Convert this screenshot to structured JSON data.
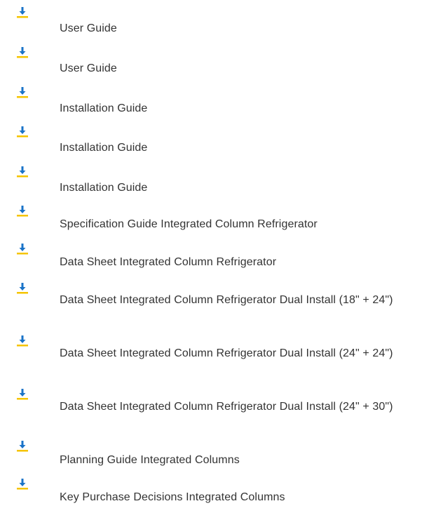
{
  "icon": "download-icon",
  "accent_color": "#1a73c8",
  "underline_color": "#f5c400",
  "documents": [
    {
      "label": "User Guide"
    },
    {
      "label": "User Guide"
    },
    {
      "label": "Installation Guide"
    },
    {
      "label": "Installation Guide"
    },
    {
      "label": "Installation Guide"
    },
    {
      "label": "Specification Guide Integrated Column Refrigerator"
    },
    {
      "label": "Data Sheet Integrated Column Refrigerator"
    },
    {
      "label": "Data Sheet Integrated Column Refrigerator  Dual Install (18\" + 24\")"
    },
    {
      "label": "Data Sheet Integrated Column Refrigerator Dual Install (24\" + 24\")"
    },
    {
      "label": "Data Sheet Integrated Column Refrigerator Dual Install (24\" + 30\")"
    },
    {
      "label": "Planning Guide Integrated Columns"
    },
    {
      "label": "Key Purchase Decisions Integrated Columns"
    }
  ]
}
